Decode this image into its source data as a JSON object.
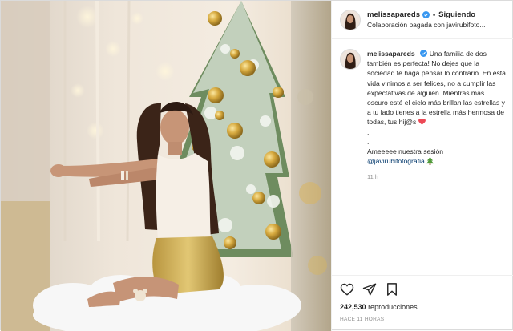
{
  "header": {
    "username": "melissapareds",
    "separator": "•",
    "follow_label": "Siguiendo",
    "subtitle": "Colaboración pagada con javirubifoto..."
  },
  "caption": {
    "username": "melissapareds",
    "text": "Una familia de dos también es perfecta! No dejes que la sociedad te haga pensar lo contrario. En esta vida vinimos a ser felices, no a cumplir las expectativas de alguien. Mientras más oscuro esté el cielo más brillan las estrellas y a tu lado tienes a la estrella más hermosa de todas, tus hij@s",
    "dot1": ".",
    "dot2": ".",
    "closing_text": "Ameeeee nuestra sesión",
    "mention": "@javirubifotografia",
    "time": "11 h"
  },
  "footer": {
    "views_count": "242,530",
    "views_label": "reproducciones",
    "posted": "HACE 11 HORAS"
  },
  "icons": {
    "verified": "verified-badge-icon",
    "like": "heart-icon",
    "share": "paper-plane-icon",
    "save": "bookmark-icon",
    "heart_emoji": "red-heart-emoji",
    "tree_emoji": "christmas-tree-emoji"
  },
  "colors": {
    "verified_blue": "#3897f0",
    "mention_blue": "#00376b",
    "heart_red": "#ed4956",
    "text_primary": "#262626",
    "text_secondary": "#8e8e8e"
  }
}
